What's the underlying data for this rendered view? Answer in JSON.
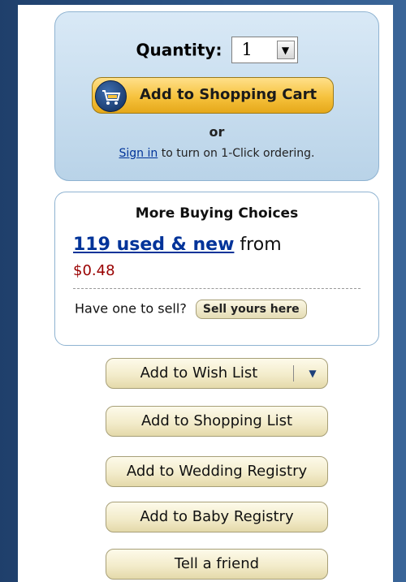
{
  "buy_box": {
    "quantity_label": "Quantity:",
    "quantity_value": "1",
    "quantity_arrow": "▼",
    "add_to_cart_label": "Add to Shopping Cart",
    "or_label": "or",
    "signin_link": "Sign in",
    "signin_suffix": "to turn on 1-Click ordering.",
    "cart_icon": "shopping-cart-icon"
  },
  "more_buying_choices": {
    "title": "More Buying Choices",
    "offers_link": "119 used & new",
    "offers_from": "from",
    "price": "$0.48",
    "sell_prompt": "Have one to sell?",
    "sell_button": "Sell yours here"
  },
  "actions": {
    "wish_list": "Add to Wish List",
    "wish_list_dropdown": "▼",
    "shopping_list": "Add to Shopping List",
    "wedding_registry": "Add to Wedding Registry",
    "baby_registry": "Add to Baby Registry",
    "tell_friend": "Tell a friend"
  },
  "colors": {
    "link": "#003399",
    "price": "#990000",
    "cart_button": "#f6c23d",
    "box_border": "#8fb3d1"
  }
}
